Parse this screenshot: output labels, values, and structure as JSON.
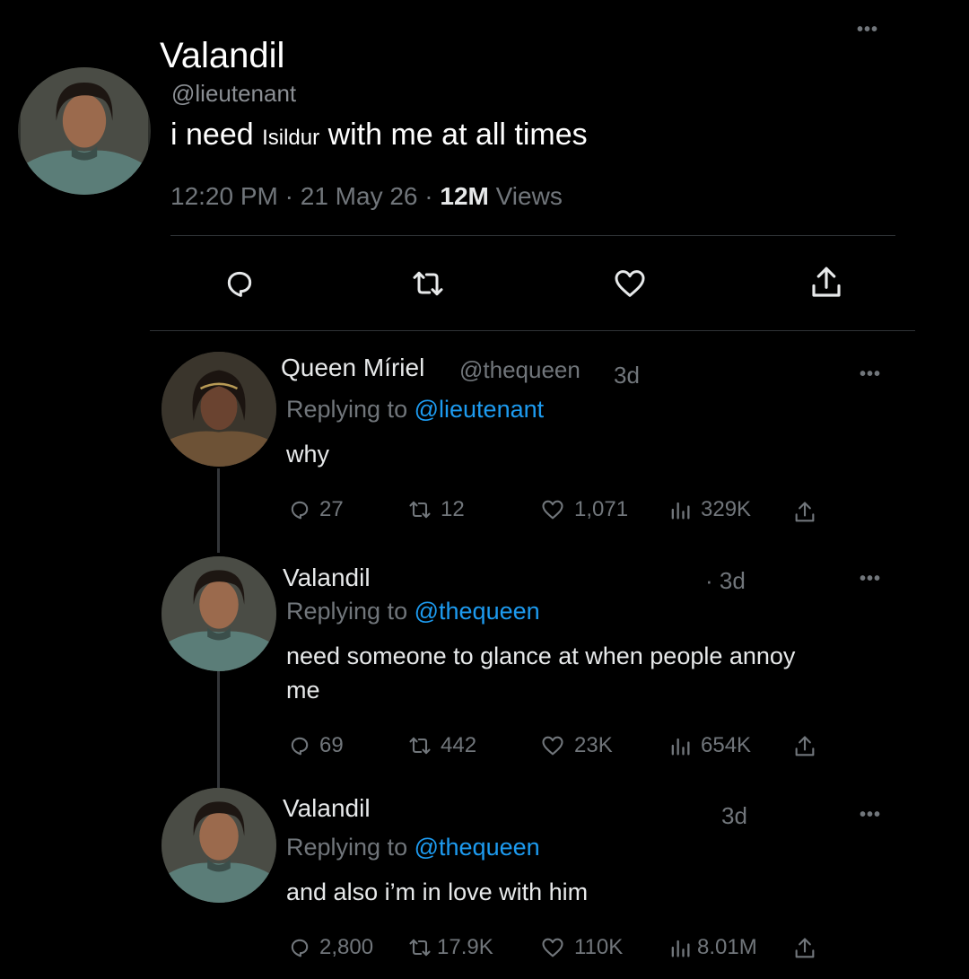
{
  "main_tweet": {
    "name": "Valandil",
    "handle": "@lieutenant",
    "text_before": "i need ",
    "text_small": "Isildur",
    "text_after": " with me at all times",
    "time": "12:20 PM",
    "date": "21 May 26",
    "views_count": "12M",
    "views_label": "Views",
    "more": "•••"
  },
  "actions": [
    "reply-icon",
    "retweet-icon",
    "like-icon",
    "share-icon"
  ],
  "replies": [
    {
      "name": "Queen Míriel",
      "handle": "@thequeen",
      "time": "3d",
      "replying_prefix": "Replying to",
      "replying_to": "@lieutenant",
      "text": "why",
      "stats": {
        "replies": "27",
        "retweets": "12",
        "likes": "1,071",
        "views": "329K"
      },
      "more": "•••"
    },
    {
      "name": "Valandil",
      "handle": "",
      "time": "· 3d",
      "replying_prefix": "Replying to",
      "replying_to": "@thequeen",
      "text": "need someone to glance at when people annoy me",
      "stats": {
        "replies": "69",
        "retweets": "442",
        "likes": "23K",
        "views": "654K"
      },
      "more": "•••"
    },
    {
      "name": "Valandil",
      "handle": "",
      "time": "3d",
      "replying_prefix": "Replying to",
      "replying_to": "@thequeen",
      "text": "and also i’m in love with him",
      "stats": {
        "replies": "2,800",
        "retweets": "17.9K",
        "likes": "110K",
        "views": "8.01M"
      },
      "more": "•••"
    }
  ],
  "colors": {
    "background": "#000000",
    "link": "#1d9bf0",
    "muted": "#71767b",
    "text": "#e7e9ea"
  }
}
